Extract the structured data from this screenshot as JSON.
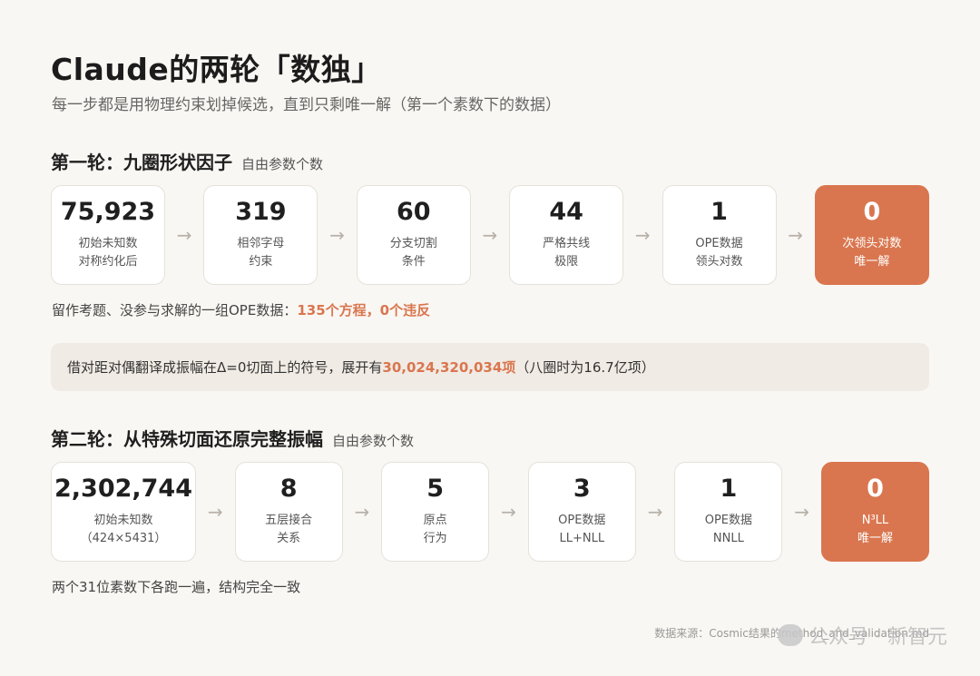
{
  "title": "Claude的两轮「数独」",
  "subtitle": "每一步都是用物理约束划掉候选，直到只剩唯一解（第一个素数下的数据）",
  "round1": {
    "heading": "第一轮：九圈形状因子",
    "note": "自由参数个数",
    "steps": [
      {
        "value": "75,923",
        "line1": "初始未知数",
        "line2": "对称约化后"
      },
      {
        "value": "319",
        "line1": "相邻字母",
        "line2": "约束"
      },
      {
        "value": "60",
        "line1": "分支切割",
        "line2": "条件"
      },
      {
        "value": "44",
        "line1": "严格共线",
        "line2": "极限"
      },
      {
        "value": "1",
        "line1": "OPE数据",
        "line2": "领头对数"
      },
      {
        "value": "0",
        "line1": "次领头对数",
        "line2": "唯一解"
      }
    ],
    "footnote_pre": "留作考题、没参与求解的一组OPE数据：",
    "footnote_accent": "135个方程，0个违反"
  },
  "callout": {
    "pre": "借对距对偶翻译成振幅在Δ=0切面上的符号，展开有",
    "accent": "30,024,320,034项",
    "post": "（八圈时为16.7亿项）"
  },
  "round2": {
    "heading": "第二轮：从特殊切面还原完整振幅",
    "note": "自由参数个数",
    "steps": [
      {
        "value": "2,302,744",
        "line1": "初始未知数",
        "line2": "（424×5431）"
      },
      {
        "value": "8",
        "line1": "五层接合",
        "line2": "关系"
      },
      {
        "value": "5",
        "line1": "原点",
        "line2": "行为"
      },
      {
        "value": "3",
        "line1": "OPE数据",
        "line2": "LL+NLL"
      },
      {
        "value": "1",
        "line1": "OPE数据",
        "line2": "NNLL"
      },
      {
        "value": "0",
        "line1": "N³LL",
        "line2": "唯一解"
      }
    ],
    "footnote": "两个31位素数下各跑一遍，结构完全一致"
  },
  "source": "数据来源：Cosmic结果的method_and_validation.md",
  "watermark": "公众号 · 新智元",
  "colors": {
    "accent": "#d9764f",
    "background": "#f9f7f3",
    "callout_bg": "#f0ebe4"
  },
  "arrow_glyph": "→"
}
